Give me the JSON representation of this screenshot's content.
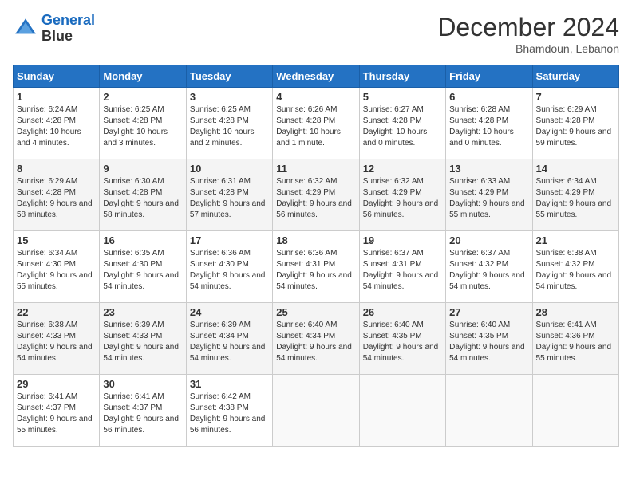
{
  "header": {
    "logo_line1": "General",
    "logo_line2": "Blue",
    "month": "December 2024",
    "location": "Bhamdoun, Lebanon"
  },
  "days_of_week": [
    "Sunday",
    "Monday",
    "Tuesday",
    "Wednesday",
    "Thursday",
    "Friday",
    "Saturday"
  ],
  "weeks": [
    [
      {
        "day": "1",
        "sunrise": "6:24 AM",
        "sunset": "4:28 PM",
        "daylight": "10 hours and 4 minutes."
      },
      {
        "day": "2",
        "sunrise": "6:25 AM",
        "sunset": "4:28 PM",
        "daylight": "10 hours and 3 minutes."
      },
      {
        "day": "3",
        "sunrise": "6:25 AM",
        "sunset": "4:28 PM",
        "daylight": "10 hours and 2 minutes."
      },
      {
        "day": "4",
        "sunrise": "6:26 AM",
        "sunset": "4:28 PM",
        "daylight": "10 hours and 1 minute."
      },
      {
        "day": "5",
        "sunrise": "6:27 AM",
        "sunset": "4:28 PM",
        "daylight": "10 hours and 0 minutes."
      },
      {
        "day": "6",
        "sunrise": "6:28 AM",
        "sunset": "4:28 PM",
        "daylight": "10 hours and 0 minutes."
      },
      {
        "day": "7",
        "sunrise": "6:29 AM",
        "sunset": "4:28 PM",
        "daylight": "9 hours and 59 minutes."
      }
    ],
    [
      {
        "day": "8",
        "sunrise": "6:29 AM",
        "sunset": "4:28 PM",
        "daylight": "9 hours and 58 minutes."
      },
      {
        "day": "9",
        "sunrise": "6:30 AM",
        "sunset": "4:28 PM",
        "daylight": "9 hours and 58 minutes."
      },
      {
        "day": "10",
        "sunrise": "6:31 AM",
        "sunset": "4:28 PM",
        "daylight": "9 hours and 57 minutes."
      },
      {
        "day": "11",
        "sunrise": "6:32 AM",
        "sunset": "4:29 PM",
        "daylight": "9 hours and 56 minutes."
      },
      {
        "day": "12",
        "sunrise": "6:32 AM",
        "sunset": "4:29 PM",
        "daylight": "9 hours and 56 minutes."
      },
      {
        "day": "13",
        "sunrise": "6:33 AM",
        "sunset": "4:29 PM",
        "daylight": "9 hours and 55 minutes."
      },
      {
        "day": "14",
        "sunrise": "6:34 AM",
        "sunset": "4:29 PM",
        "daylight": "9 hours and 55 minutes."
      }
    ],
    [
      {
        "day": "15",
        "sunrise": "6:34 AM",
        "sunset": "4:30 PM",
        "daylight": "9 hours and 55 minutes."
      },
      {
        "day": "16",
        "sunrise": "6:35 AM",
        "sunset": "4:30 PM",
        "daylight": "9 hours and 54 minutes."
      },
      {
        "day": "17",
        "sunrise": "6:36 AM",
        "sunset": "4:30 PM",
        "daylight": "9 hours and 54 minutes."
      },
      {
        "day": "18",
        "sunrise": "6:36 AM",
        "sunset": "4:31 PM",
        "daylight": "9 hours and 54 minutes."
      },
      {
        "day": "19",
        "sunrise": "6:37 AM",
        "sunset": "4:31 PM",
        "daylight": "9 hours and 54 minutes."
      },
      {
        "day": "20",
        "sunrise": "6:37 AM",
        "sunset": "4:32 PM",
        "daylight": "9 hours and 54 minutes."
      },
      {
        "day": "21",
        "sunrise": "6:38 AM",
        "sunset": "4:32 PM",
        "daylight": "9 hours and 54 minutes."
      }
    ],
    [
      {
        "day": "22",
        "sunrise": "6:38 AM",
        "sunset": "4:33 PM",
        "daylight": "9 hours and 54 minutes."
      },
      {
        "day": "23",
        "sunrise": "6:39 AM",
        "sunset": "4:33 PM",
        "daylight": "9 hours and 54 minutes."
      },
      {
        "day": "24",
        "sunrise": "6:39 AM",
        "sunset": "4:34 PM",
        "daylight": "9 hours and 54 minutes."
      },
      {
        "day": "25",
        "sunrise": "6:40 AM",
        "sunset": "4:34 PM",
        "daylight": "9 hours and 54 minutes."
      },
      {
        "day": "26",
        "sunrise": "6:40 AM",
        "sunset": "4:35 PM",
        "daylight": "9 hours and 54 minutes."
      },
      {
        "day": "27",
        "sunrise": "6:40 AM",
        "sunset": "4:35 PM",
        "daylight": "9 hours and 54 minutes."
      },
      {
        "day": "28",
        "sunrise": "6:41 AM",
        "sunset": "4:36 PM",
        "daylight": "9 hours and 55 minutes."
      }
    ],
    [
      {
        "day": "29",
        "sunrise": "6:41 AM",
        "sunset": "4:37 PM",
        "daylight": "9 hours and 55 minutes."
      },
      {
        "day": "30",
        "sunrise": "6:41 AM",
        "sunset": "4:37 PM",
        "daylight": "9 hours and 56 minutes."
      },
      {
        "day": "31",
        "sunrise": "6:42 AM",
        "sunset": "4:38 PM",
        "daylight": "9 hours and 56 minutes."
      },
      null,
      null,
      null,
      null
    ]
  ]
}
